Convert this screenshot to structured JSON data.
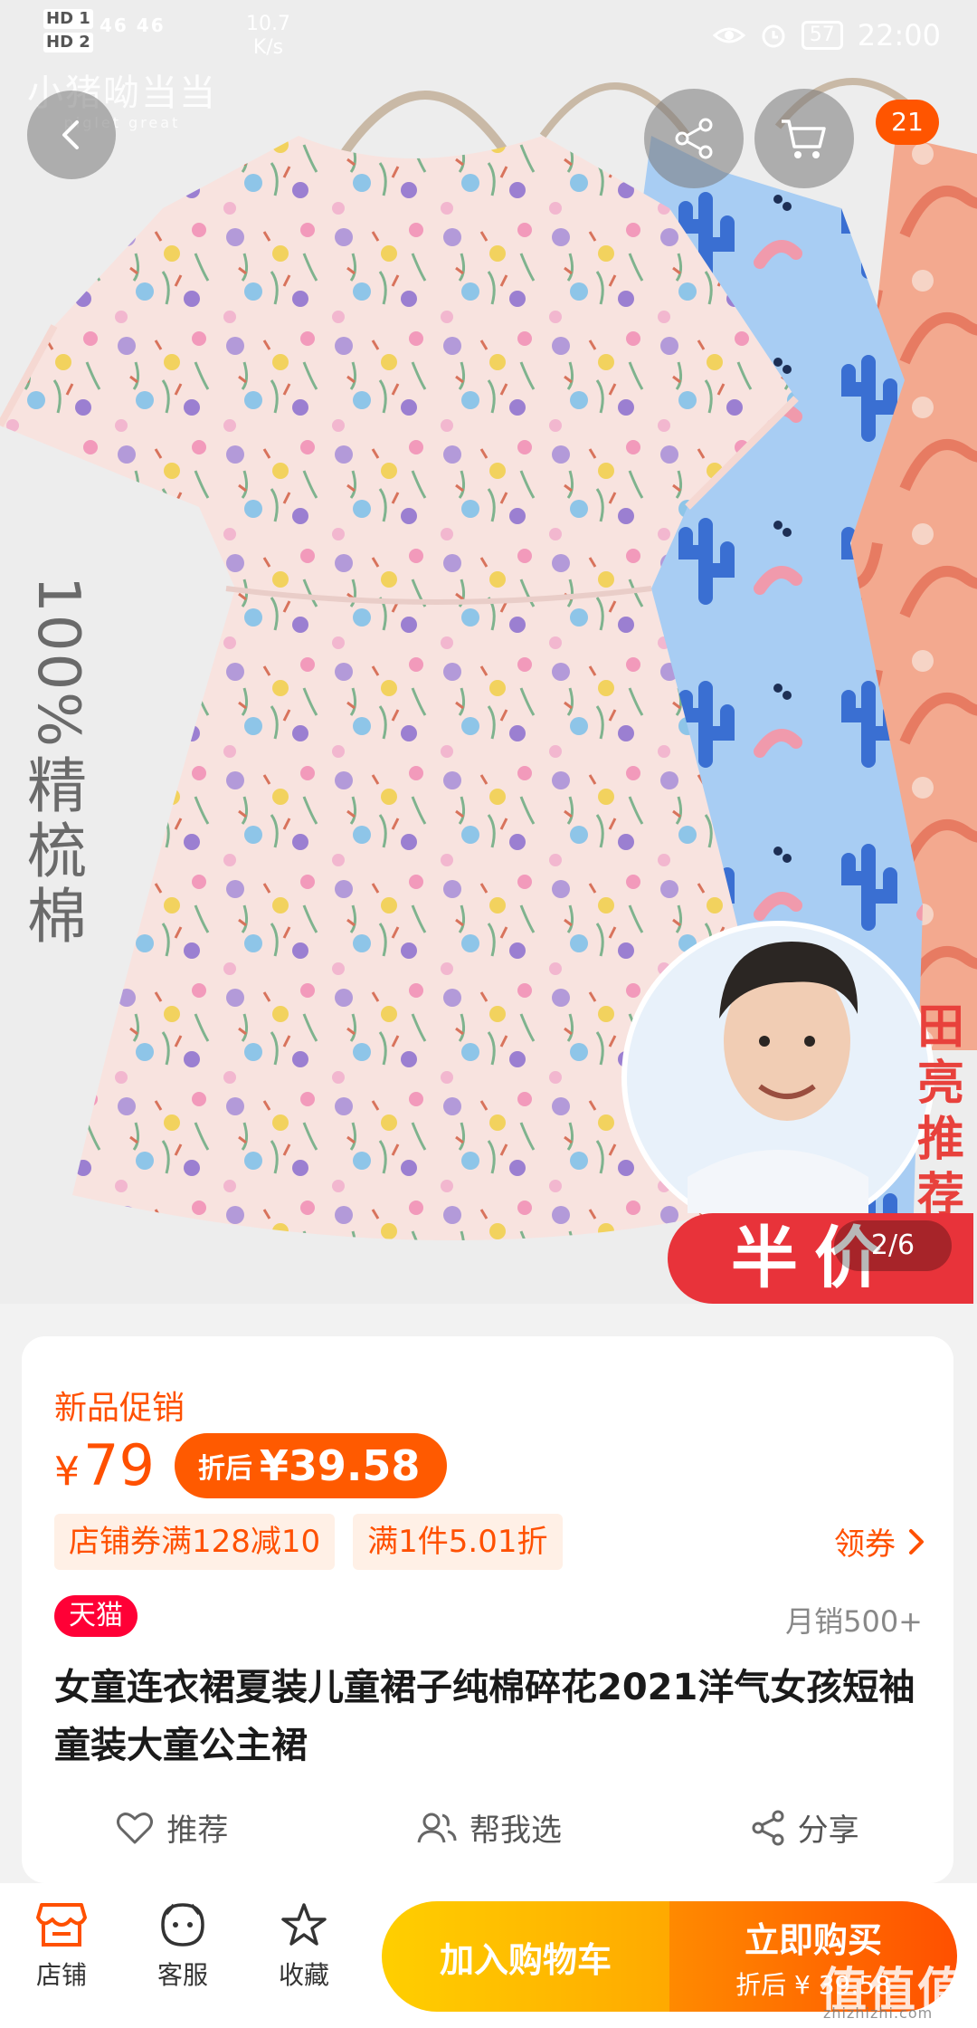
{
  "status_bar": {
    "sim_labels": [
      "HD 1",
      "HD 2"
    ],
    "network": "46 46",
    "speed": "10.7",
    "speed_unit": "K/s",
    "battery": "57",
    "time": "22:00"
  },
  "brand": {
    "cn": "小猪呦当当",
    "en": "piglet great"
  },
  "header": {
    "cart_count": "21"
  },
  "image_overlays": {
    "cotton_percent": "100%",
    "cotton_chars": [
      "精",
      "梳",
      "棉"
    ],
    "endorser_chars": [
      "田",
      "亮",
      "推",
      "荐"
    ],
    "half_price": "半价",
    "page_indicator": "2/6"
  },
  "product": {
    "promo_title": "新品促销",
    "currency": "¥",
    "price": "79",
    "after_label": "折后",
    "after_price": "¥39.58",
    "coupons": [
      "店铺券满128减10",
      "满1件5.01折"
    ],
    "get_coupon": "领券",
    "tmall": "天猫",
    "monthly_sales": "月销500+",
    "title": "女童连衣裙夏装儿童裙子纯棉碎花2021洋气女孩短袖童装大童公主裙"
  },
  "actions": {
    "recommend": "推荐",
    "help_choose": "帮我选",
    "share": "分享"
  },
  "bottom_bar": {
    "shop": "店铺",
    "service": "客服",
    "favorite": "收藏",
    "add_cart": "加入购物车",
    "buy_now": "立即购买",
    "buy_now_sub": "折后 ¥ 39.58"
  },
  "watermark": {
    "text": "值值值",
    "url": "zhizhizhi.com"
  },
  "colors": {
    "accent": "#ff5000",
    "tmall": "#ff0036",
    "cart_yellow": "#ffb800",
    "sale_red": "#e8333a"
  }
}
